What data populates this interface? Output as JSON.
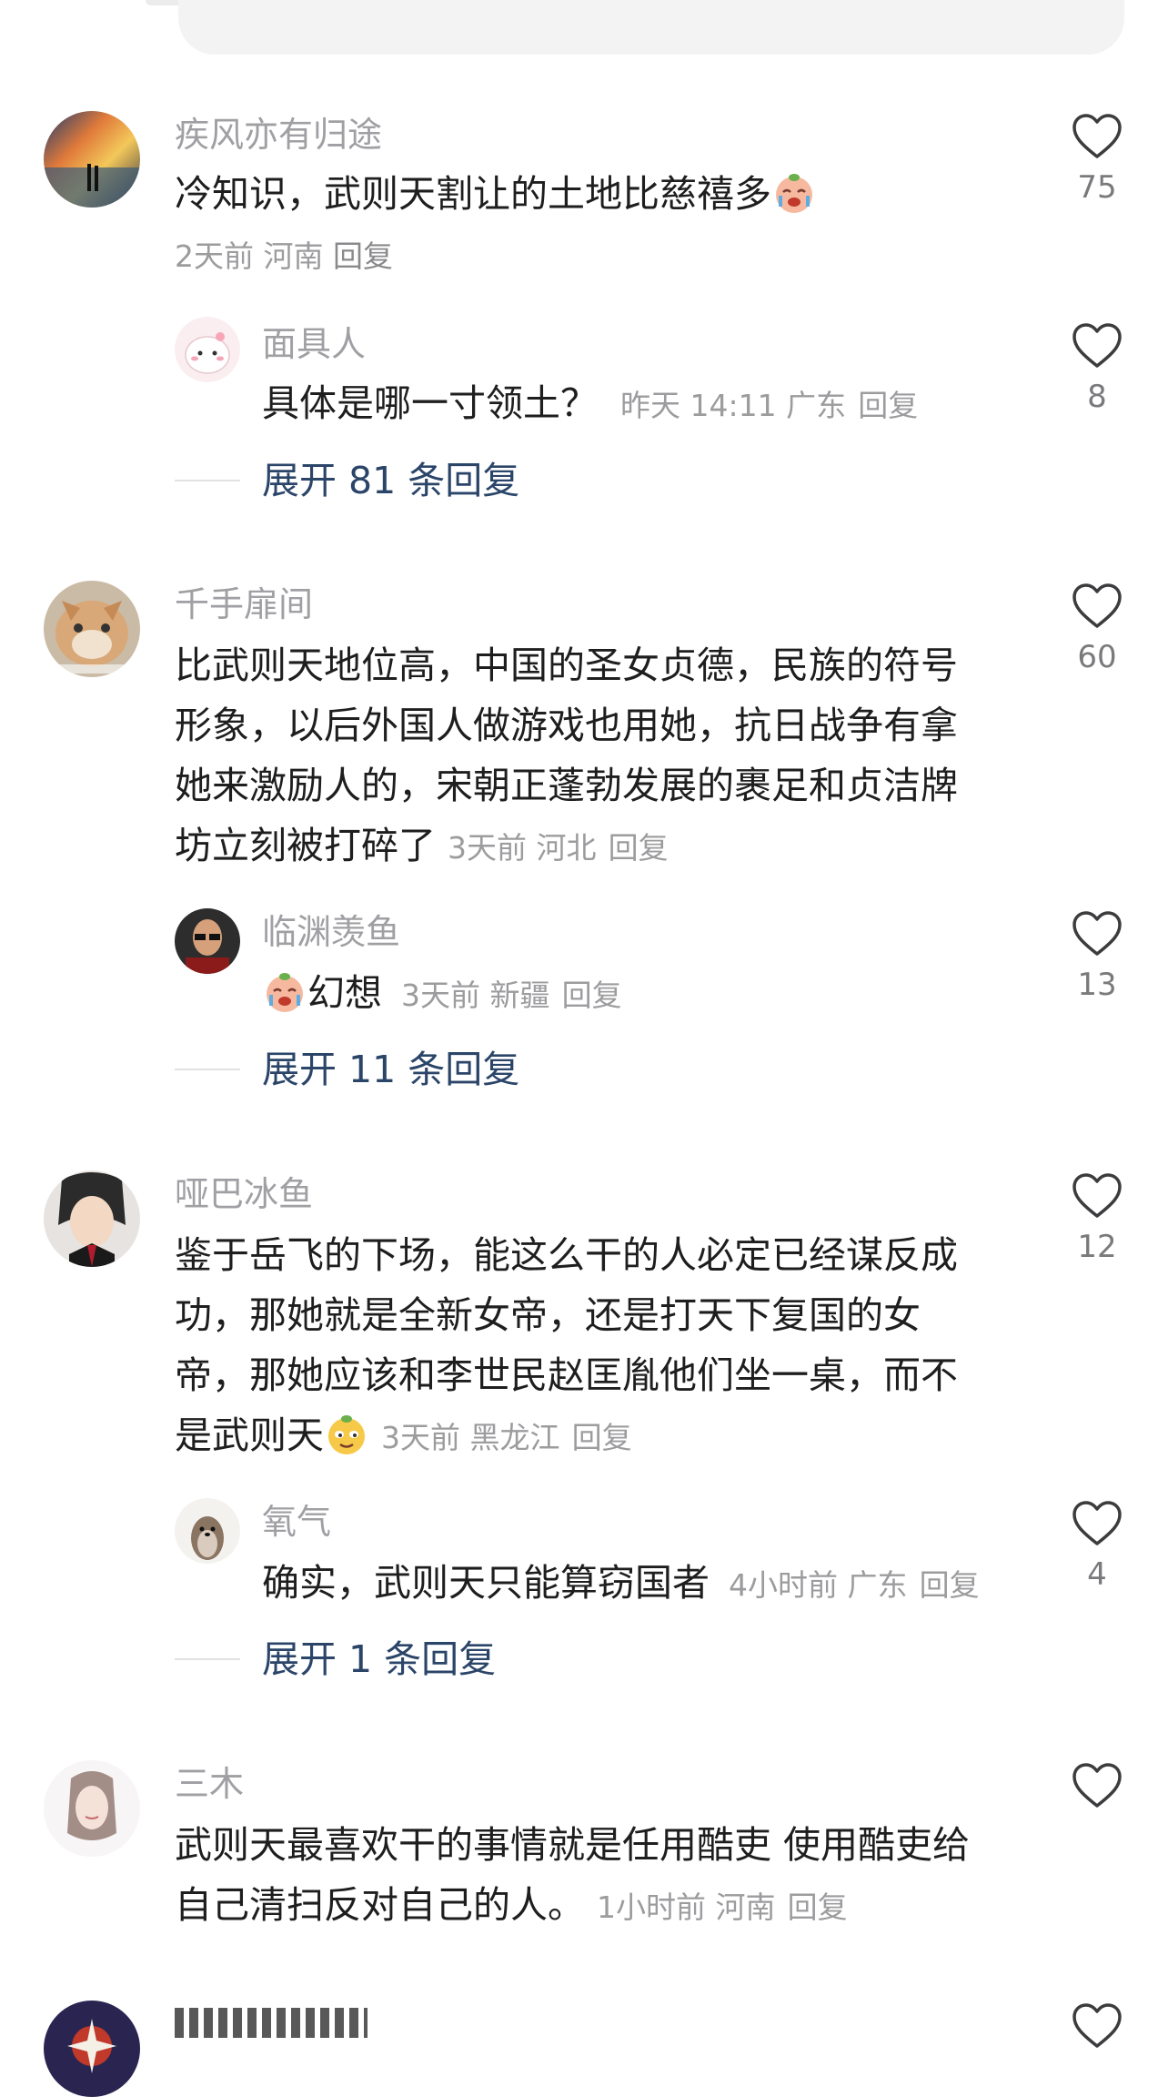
{
  "comments": [
    {
      "user": "疾风亦有归途",
      "text": "冷知识，武则天割让的土地比慈禧多",
      "meta": "2天前 河南",
      "reply_label": "回复",
      "likes": "75",
      "sub": {
        "user": "面具人",
        "text": "具体是哪一寸领土？",
        "meta": "昨天 14:11 广东",
        "reply_label": "回复",
        "likes": "8"
      },
      "expand": "展开 81 条回复"
    },
    {
      "user": "千手扉间",
      "lines": [
        "比武则天地位高，中国的圣女贞德，民族的符号",
        "形象，以后外国人做游戏也用她，抗日战争有拿",
        "她来激励人的，宋朝正蓬勃发展的裹足和贞洁牌",
        "坊立刻被打碎了"
      ],
      "meta": "3天前 河北",
      "reply_label": "回复",
      "likes": "60",
      "sub": {
        "user": "临渊羡鱼",
        "text": "幻想",
        "meta": "3天前 新疆",
        "reply_label": "回复",
        "likes": "13"
      },
      "expand": "展开 11 条回复"
    },
    {
      "user": "哑巴冰鱼",
      "lines": [
        "鉴于岳飞的下场，能这么干的人必定已经谋反成",
        "功，那她就是全新女帝，还是打天下复国的女",
        "帝，那她应该和李世民赵匡胤他们坐一桌，而不",
        "是武则天"
      ],
      "meta": "3天前 黑龙江",
      "reply_label": "回复",
      "likes": "12",
      "sub": {
        "user": "氧气",
        "text": "确实，武则天只能算窃国者",
        "meta": "4小时前 广东",
        "reply_label": "回复",
        "likes": "4"
      },
      "expand": "展开 1 条回复"
    },
    {
      "user": "三木",
      "lines": [
        "武则天最喜欢干的事情就是任用酷吏 使用酷吏给",
        "自己清扫反对自己的人。"
      ],
      "meta": "1小时前 河南",
      "reply_label": "回复",
      "likes": ""
    }
  ],
  "colors": {
    "name": "#a0a0a4",
    "text": "#1e1e1e",
    "meta": "#9c9c9f",
    "expand": "#2b4569"
  },
  "icons": [
    "heart-outline-icon",
    "crying-face-emoji",
    "smirk-face-emoji"
  ]
}
